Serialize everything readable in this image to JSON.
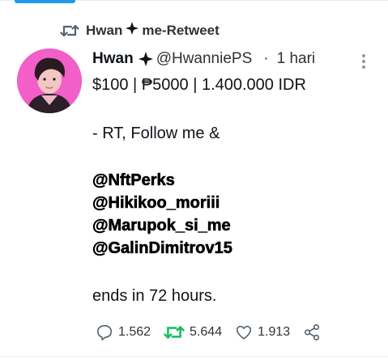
{
  "retweet_header": {
    "name": "Hwan",
    "suffix": "me-Retweet"
  },
  "tweet": {
    "name": "Hwan",
    "handle": "@HwanniePS",
    "separator": "·",
    "time": "1 hari",
    "lines": {
      "prices": "$100 | ₱5000 | 1.400.000 IDR",
      "instruction": "- RT, Follow me &",
      "mention1": "@NftPerks",
      "mention2": "@Hikikoo_moriii",
      "mention3": "@Marupok_si_me",
      "mention4": "@GalinDimitrov15",
      "ending": "ends in 72 hours."
    }
  },
  "actions": {
    "replies": "1.562",
    "retweets": "5.644",
    "likes": "1.913"
  },
  "colors": {
    "retweet_green": "#17bf63",
    "accent_blue": "#1d9bf0",
    "avatar_bg": "#f35fc9"
  },
  "icons": [
    "retweet-icon",
    "sparkle-badge-icon",
    "more-icon",
    "reply-icon",
    "retweet-action-icon",
    "like-icon",
    "share-icon"
  ]
}
